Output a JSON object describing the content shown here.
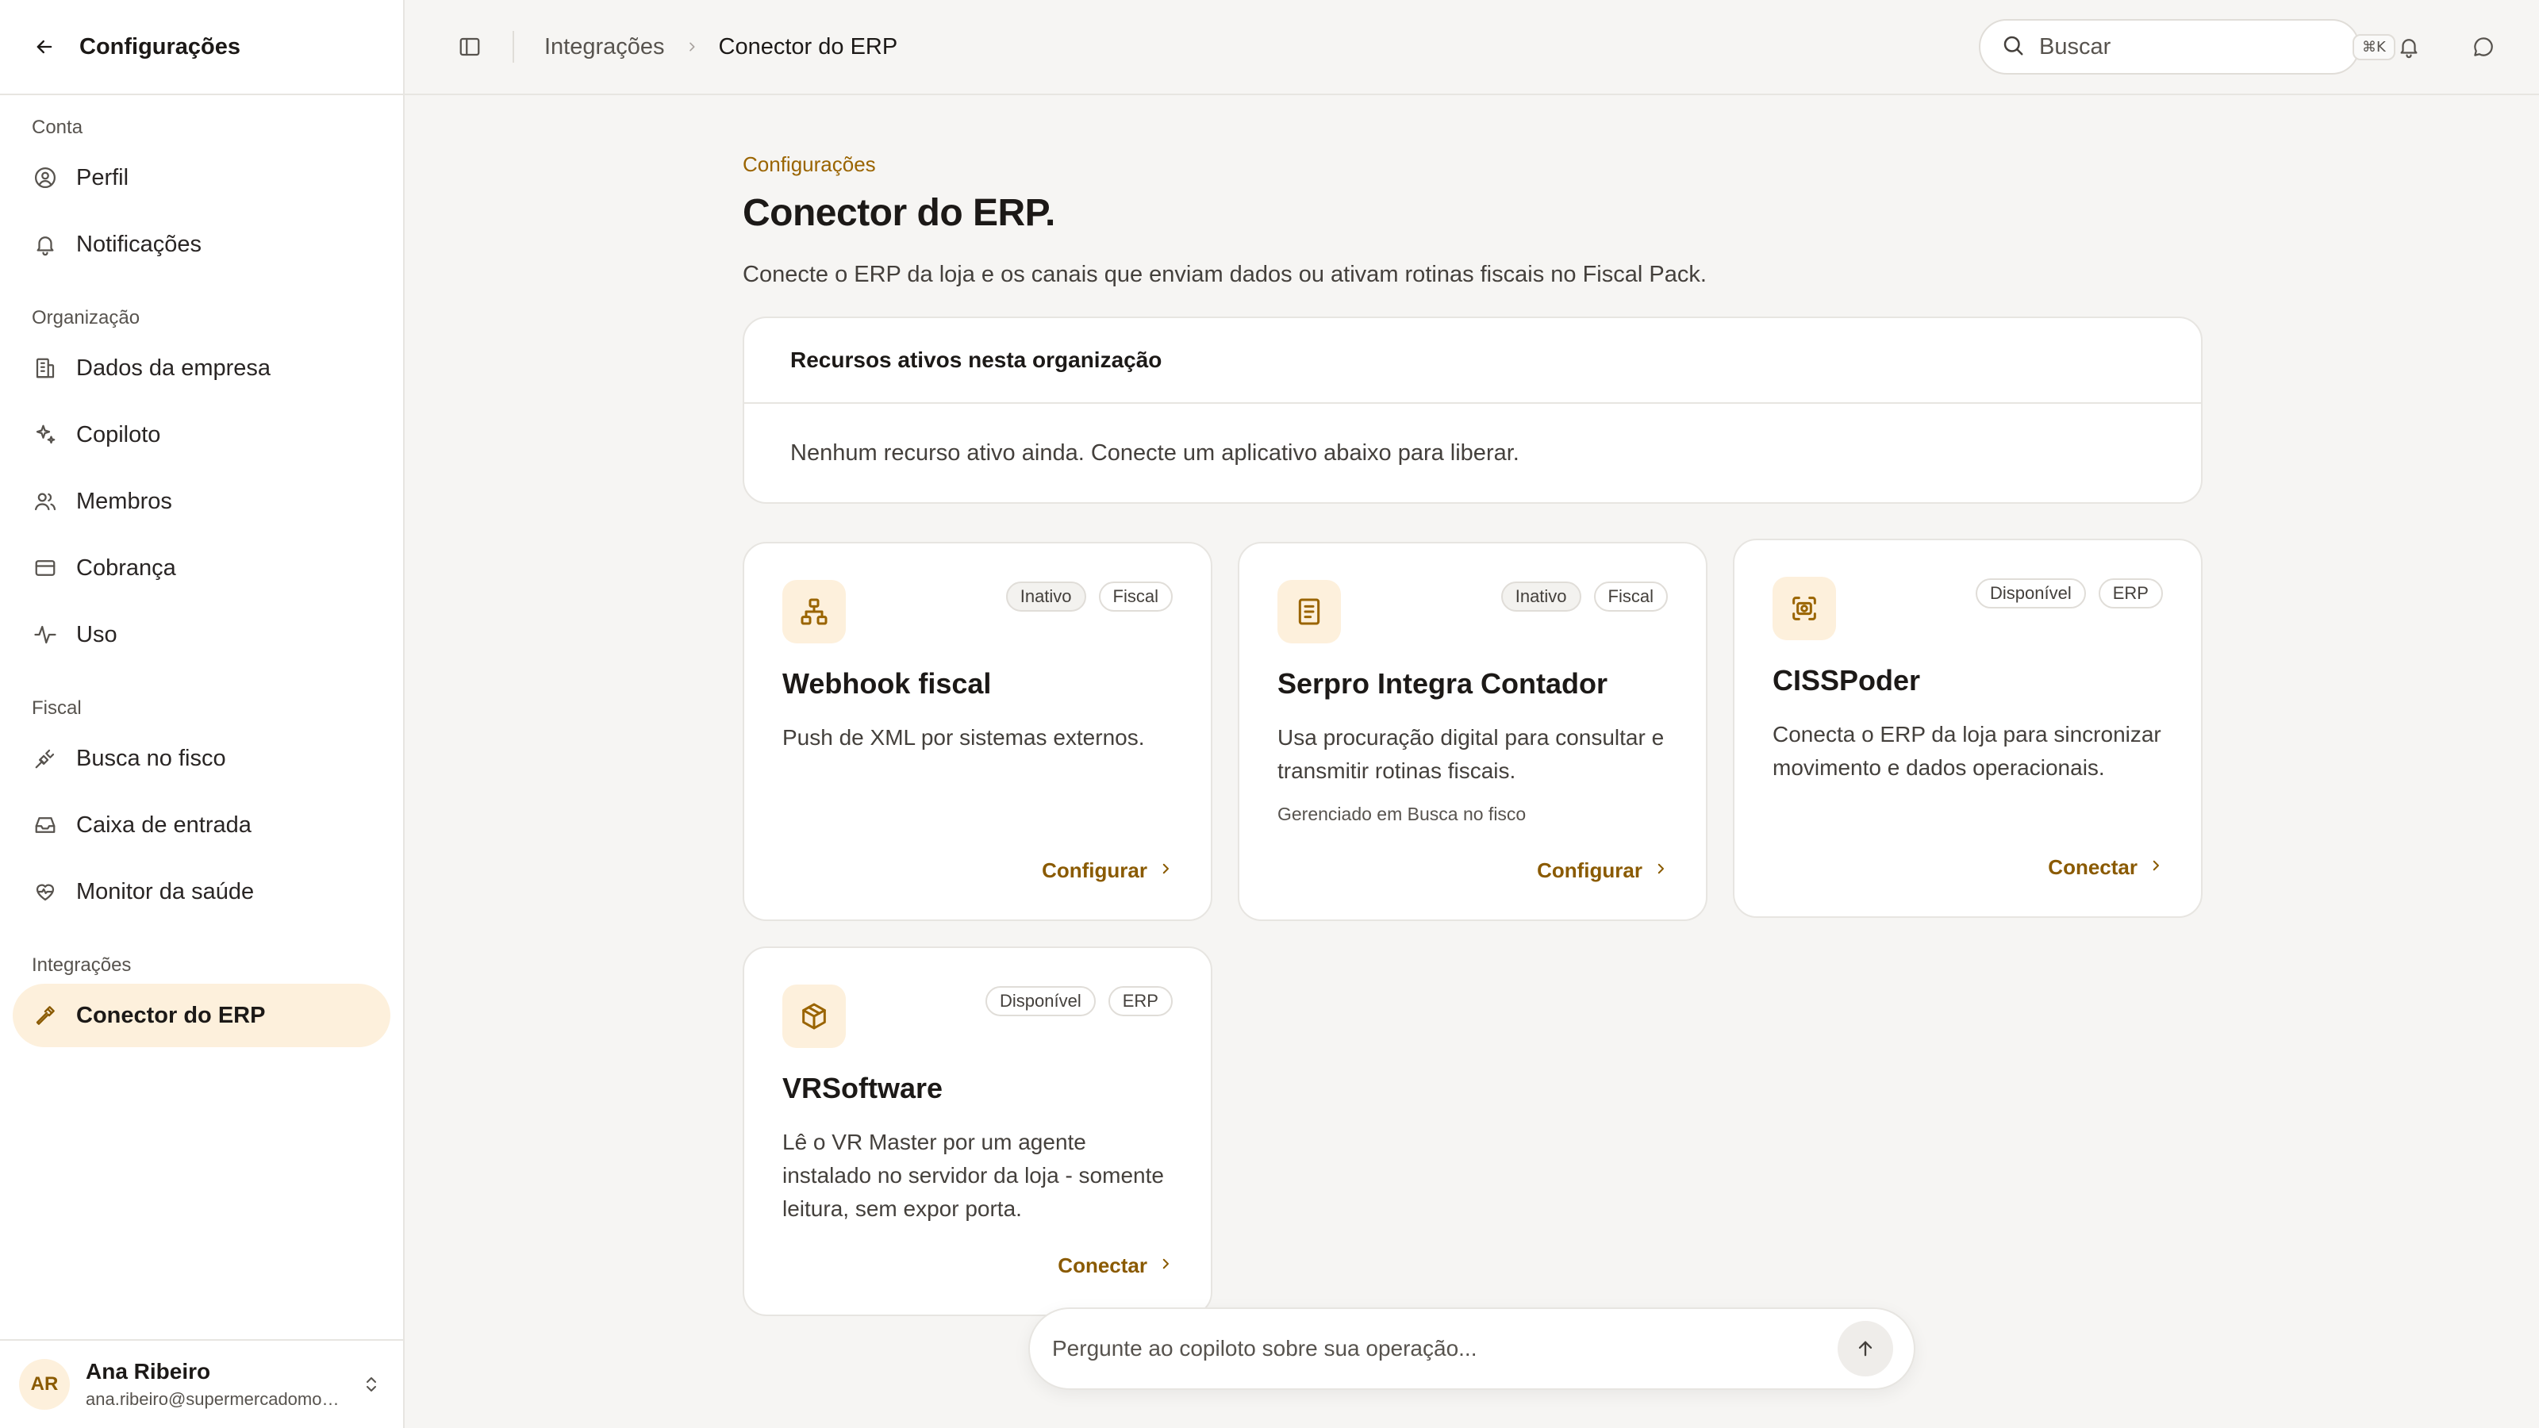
{
  "sidebar": {
    "title": "Configurações",
    "sections": [
      {
        "label": "Conta",
        "items": [
          {
            "label": "Perfil",
            "icon": "user-circle-icon"
          },
          {
            "label": "Notificações",
            "icon": "bell-icon"
          }
        ]
      },
      {
        "label": "Organização",
        "items": [
          {
            "label": "Dados da empresa",
            "icon": "building-icon"
          },
          {
            "label": "Copiloto",
            "icon": "sparkles-icon"
          },
          {
            "label": "Membros",
            "icon": "users-icon"
          },
          {
            "label": "Cobrança",
            "icon": "credit-card-icon"
          },
          {
            "label": "Uso",
            "icon": "activity-icon"
          }
        ]
      },
      {
        "label": "Fiscal",
        "items": [
          {
            "label": "Busca no fisco",
            "icon": "plug-icon"
          },
          {
            "label": "Caixa de entrada",
            "icon": "inbox-icon"
          },
          {
            "label": "Monitor da saúde",
            "icon": "heart-pulse-icon"
          }
        ]
      },
      {
        "label": "Integrações",
        "items": [
          {
            "label": "Conector do ERP",
            "icon": "hammer-icon",
            "active": true
          }
        ]
      }
    ],
    "user": {
      "initials": "AR",
      "name": "Ana Ribeiro",
      "email": "ana.ribeiro@supermercadomod..."
    }
  },
  "topbar": {
    "breadcrumb": [
      "Integrações",
      "Conector do ERP"
    ],
    "search": {
      "placeholder": "Buscar",
      "shortcut": "⌘K"
    }
  },
  "main": {
    "eyebrow": "Configurações",
    "title": "Conector do ERP.",
    "description": "Conecte o ERP da loja e os canais que enviam dados ou ativam rotinas fiscais no Fiscal Pack.",
    "resources": {
      "title": "Recursos ativos nesta organização",
      "empty": "Nenhum recurso ativo ainda. Conecte um aplicativo abaixo para liberar."
    },
    "cards": [
      {
        "name": "Webhook fiscal",
        "icon": "network-icon",
        "tags": [
          "Inativo",
          "Fiscal"
        ],
        "description": "Push de XML por sistemas externos.",
        "note": "",
        "action": "Configurar"
      },
      {
        "name": "Serpro Integra Contador",
        "icon": "document-icon",
        "tags": [
          "Inativo",
          "Fiscal"
        ],
        "description": "Usa procuração digital para consultar e transmitir rotinas fiscais.",
        "note": "Gerenciado em Busca no fisco",
        "action": "Configurar"
      },
      {
        "name": "CISSPoder",
        "icon": "scan-icon",
        "tags": [
          "Disponível",
          "ERP"
        ],
        "description": "Conecta o ERP da loja para sincronizar movimento e dados operacionais.",
        "note": "",
        "action": "Conectar"
      },
      {
        "name": "VRSoftware",
        "icon": "package-icon",
        "tags": [
          "Disponível",
          "ERP"
        ],
        "description": "Lê o VR Master por um agente instalado no servidor da loja - somente leitura, sem expor porta.",
        "note": "",
        "action": "Conectar"
      }
    ]
  },
  "copilot": {
    "placeholder": "Pergunte ao copiloto sobre sua operação..."
  },
  "colors": {
    "accent": "#8a5a00",
    "accent_soft": "#fdf0dc",
    "background": "#f6f5f3",
    "border": "#e7e5e1"
  }
}
